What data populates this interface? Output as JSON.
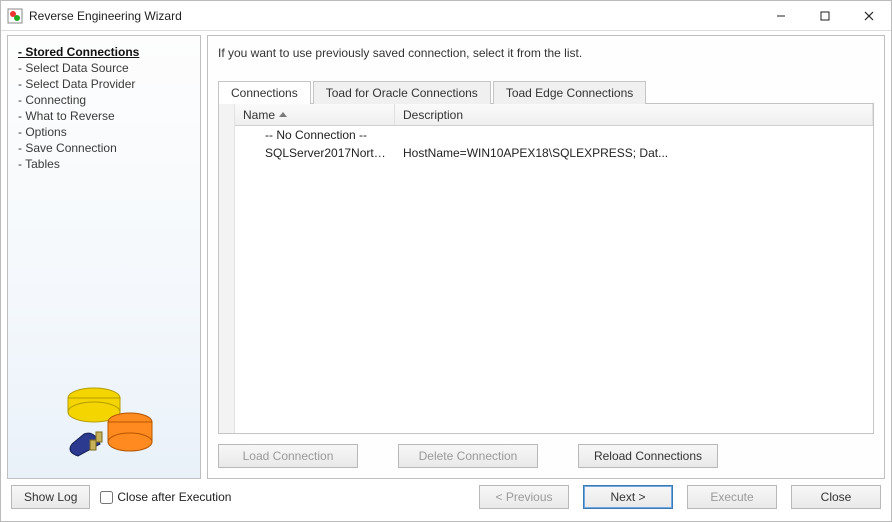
{
  "window": {
    "title": "Reverse Engineering Wizard"
  },
  "steps": [
    {
      "label": "Stored Connections",
      "current": true
    },
    {
      "label": "Select Data Source",
      "current": false
    },
    {
      "label": "Select Data Provider",
      "current": false
    },
    {
      "label": "Connecting",
      "current": false
    },
    {
      "label": "What to Reverse",
      "current": false
    },
    {
      "label": "Options",
      "current": false
    },
    {
      "label": "Save Connection",
      "current": false
    },
    {
      "label": "Tables",
      "current": false
    }
  ],
  "hint": "If you want to use previously saved connection, select it from the list.",
  "tabs": [
    {
      "label": "Connections",
      "active": true
    },
    {
      "label": "Toad for Oracle Connections",
      "active": false
    },
    {
      "label": "Toad Edge Connections",
      "active": false
    }
  ],
  "columns": {
    "name": "Name",
    "desc": "Description"
  },
  "rows": [
    {
      "name": "-- No Connection --",
      "desc": ""
    },
    {
      "name": "SQLServer2017Northw...",
      "desc": "HostName=WIN10APEX18\\SQLEXPRESS; Dat..."
    }
  ],
  "actions": {
    "load": "Load Connection",
    "delete": "Delete Connection",
    "reload": "Reload Connections"
  },
  "bottom": {
    "show_log": "Show Log",
    "close_after": "Close after Execution",
    "previous": "< Previous",
    "next": "Next >",
    "execute": "Execute",
    "close": "Close"
  }
}
